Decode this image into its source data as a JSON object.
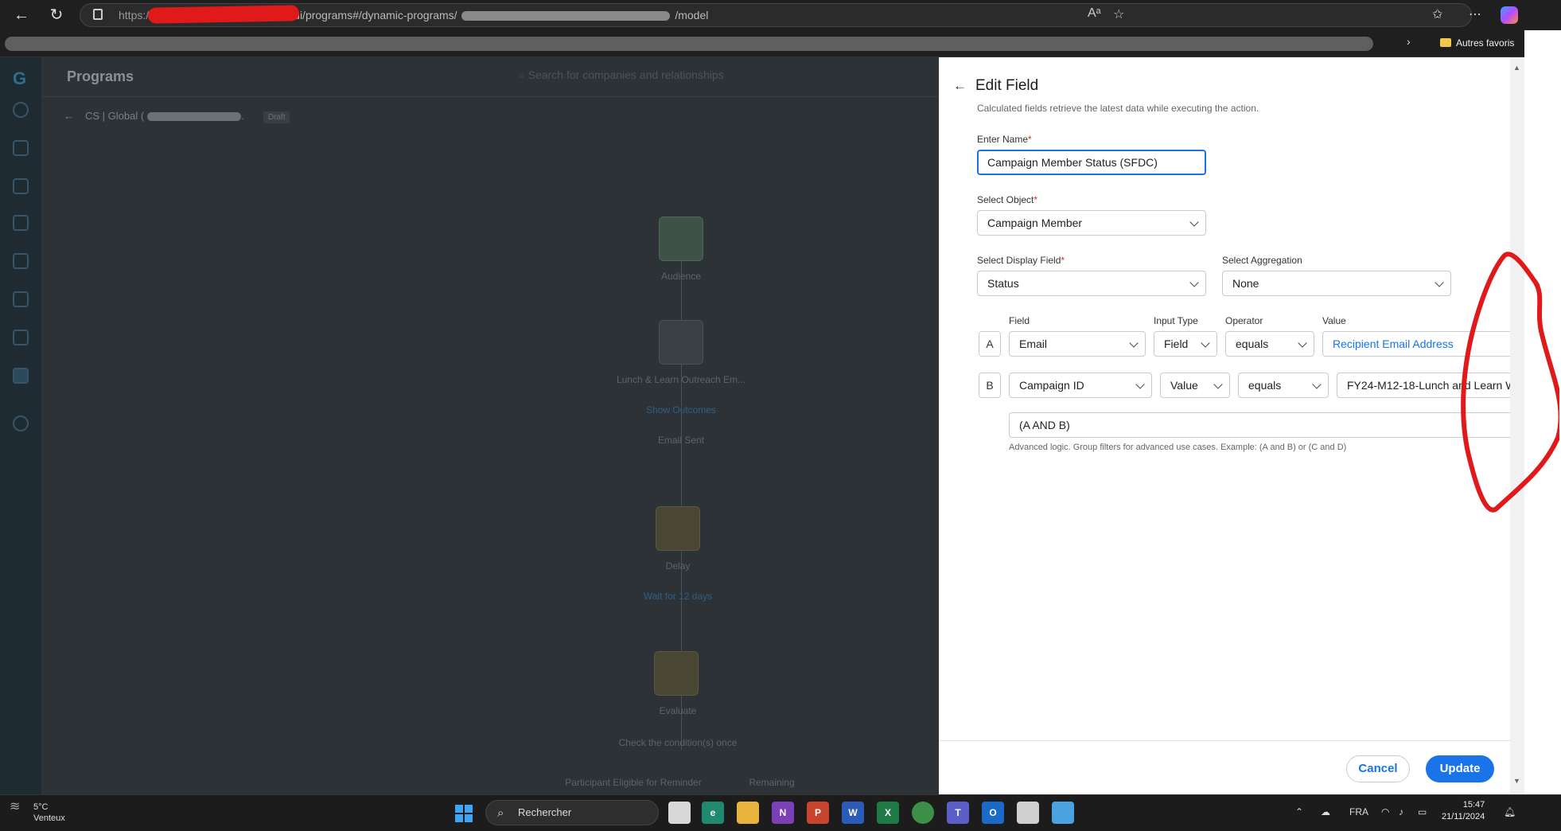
{
  "browser": {
    "url_prefix": "https:/",
    "url_path": ".../v1/ui/programs#/dynamic-programs/",
    "url_suffix": "/model",
    "bookmark_folder": "Autres favoris"
  },
  "app": {
    "title": "Programs",
    "search_placeholder": "Search for companies and relationships",
    "breadcrumb": "CS | Global (",
    "status_badge": "Draft",
    "flow": {
      "audience": "Audience",
      "email_node": "Lunch & Learn Outreach Em...",
      "show_outcomes": "Show Outcomes",
      "email_sent": "Email Sent",
      "delay": "Delay",
      "wait": "Wait for 12 days",
      "evaluate": "Evaluate",
      "check": "Check the condition(s) once",
      "branch_left": "Participant Eligible for Reminder",
      "branch_right": "Remaining"
    }
  },
  "dialog": {
    "title": "Edit Field",
    "subtitle": "Calculated fields retrieve the latest data while executing the action.",
    "name_label": "Enter Name",
    "name_value": "Campaign Member Status (SFDC)",
    "object_label": "Select Object",
    "object_value": "Campaign Member",
    "display_field_label": "Select Display Field",
    "display_field_value": "Status",
    "aggregation_label": "Select Aggregation",
    "aggregation_value": "None",
    "headers": {
      "field": "Field",
      "input_type": "Input Type",
      "operator": "Operator",
      "value": "Value"
    },
    "filters": [
      {
        "letter": "A",
        "field": "Email",
        "input_type": "Field",
        "operator": "equals",
        "value": "Recipient Email Address"
      },
      {
        "letter": "B",
        "field": "Campaign ID",
        "input_type": "Value",
        "operator": "equals",
        "value": "FY24-M12-18-Lunch and Learn W"
      }
    ],
    "advanced_logic_value": "(A AND B)",
    "advanced_logic_hint": "Advanced logic. Group filters for advanced use cases. Example: (A and B) or (C and D)",
    "cancel_label": "Cancel",
    "update_label": "Update"
  },
  "taskbar": {
    "temperature": "5°C",
    "weather": "Venteux",
    "search_label": "Rechercher",
    "language": "FRA",
    "time": "15:47",
    "date": "21/11/2024"
  },
  "colors": {
    "accent": "#1a73e8",
    "annotation": "#e0191b"
  }
}
